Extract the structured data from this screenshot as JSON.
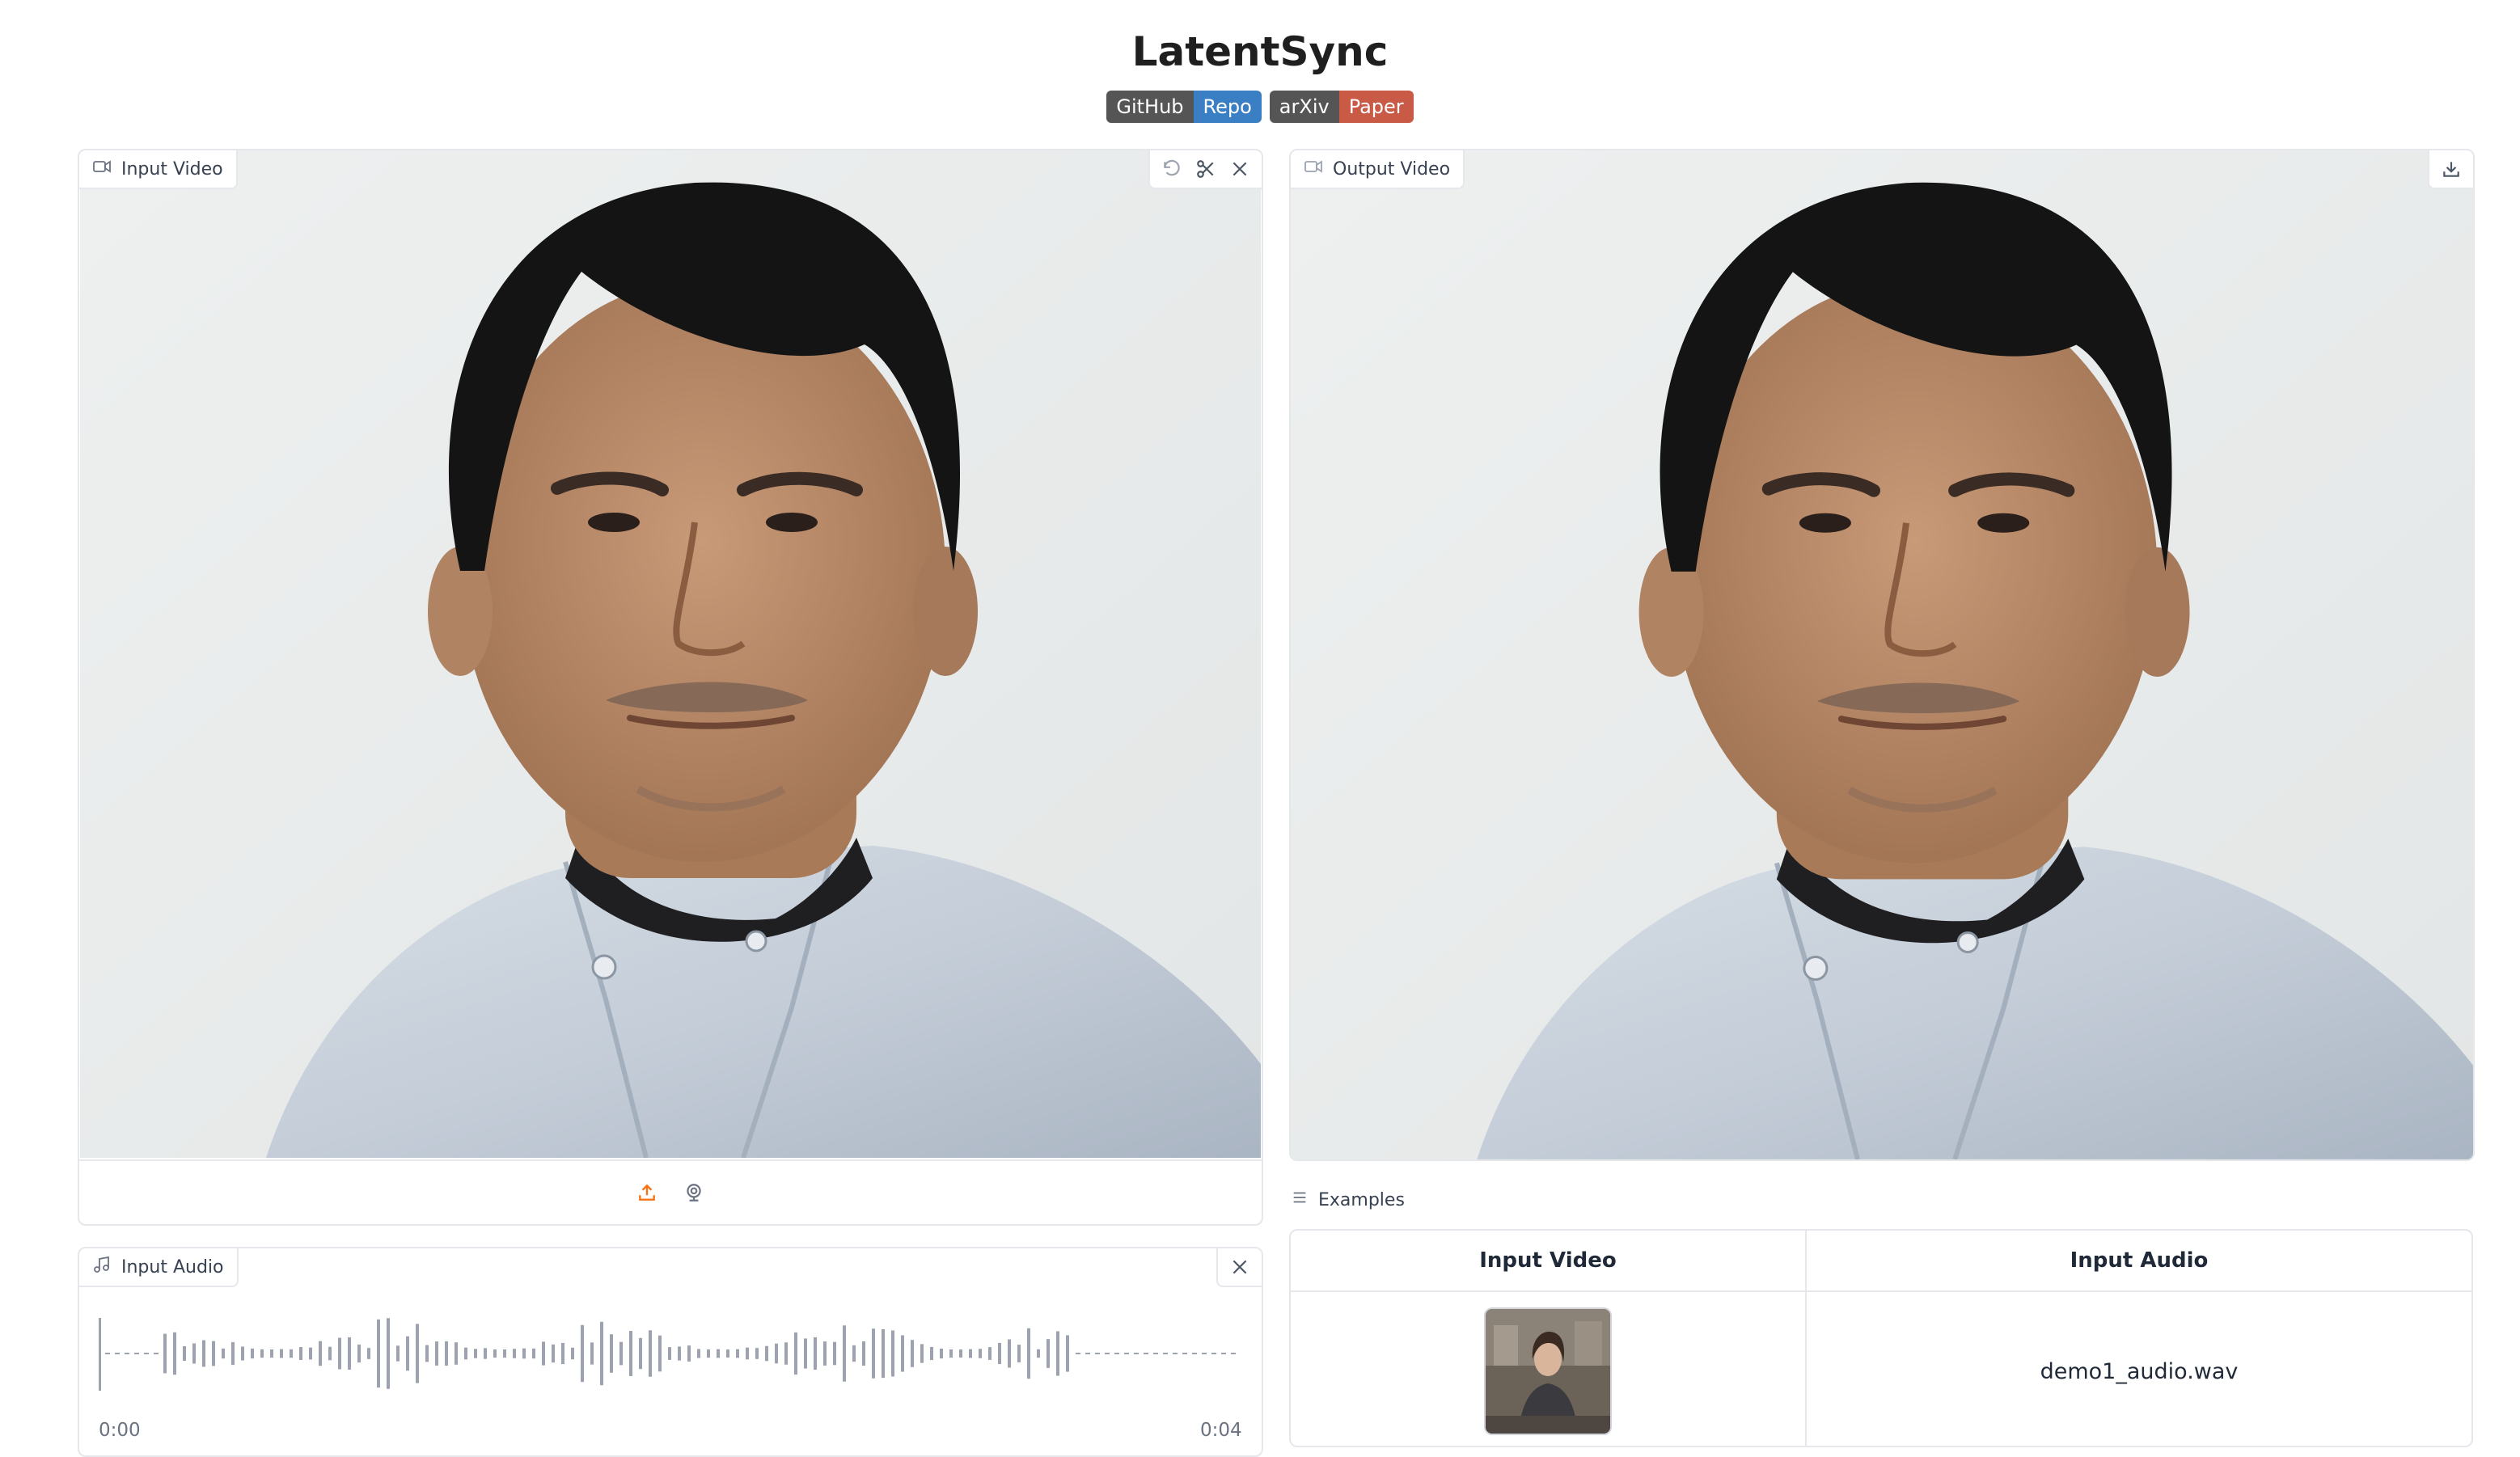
{
  "app": {
    "title": "LatentSync",
    "badges": [
      {
        "left": "GitHub",
        "right": "Repo",
        "color": "#3a7fc4"
      },
      {
        "left": "arXiv",
        "right": "Paper",
        "color": "#c85a46"
      }
    ]
  },
  "input_video": {
    "label": "Input Video",
    "label_icon": "video-camera-icon",
    "tools": [
      "undo-icon",
      "scissors-icon",
      "close-icon"
    ],
    "sources": [
      "upload-icon",
      "webcam-icon"
    ]
  },
  "output_video": {
    "label": "Output Video",
    "label_icon": "video-camera-icon",
    "tools": [
      "download-icon"
    ]
  },
  "input_audio": {
    "label": "Input Audio",
    "label_icon": "music-note-icon",
    "time_start": "0:00",
    "time_end": "0:04"
  },
  "examples": {
    "label": "Examples",
    "headers": [
      "Input Video",
      "Input Audio"
    ],
    "rows": [
      {
        "audio": "demo1_audio.wav"
      }
    ]
  },
  "colors": {
    "accent": "#f97316",
    "border": "#e5e7eb",
    "github_badge": "#3a7fc4",
    "arxiv_badge": "#c85a46"
  }
}
